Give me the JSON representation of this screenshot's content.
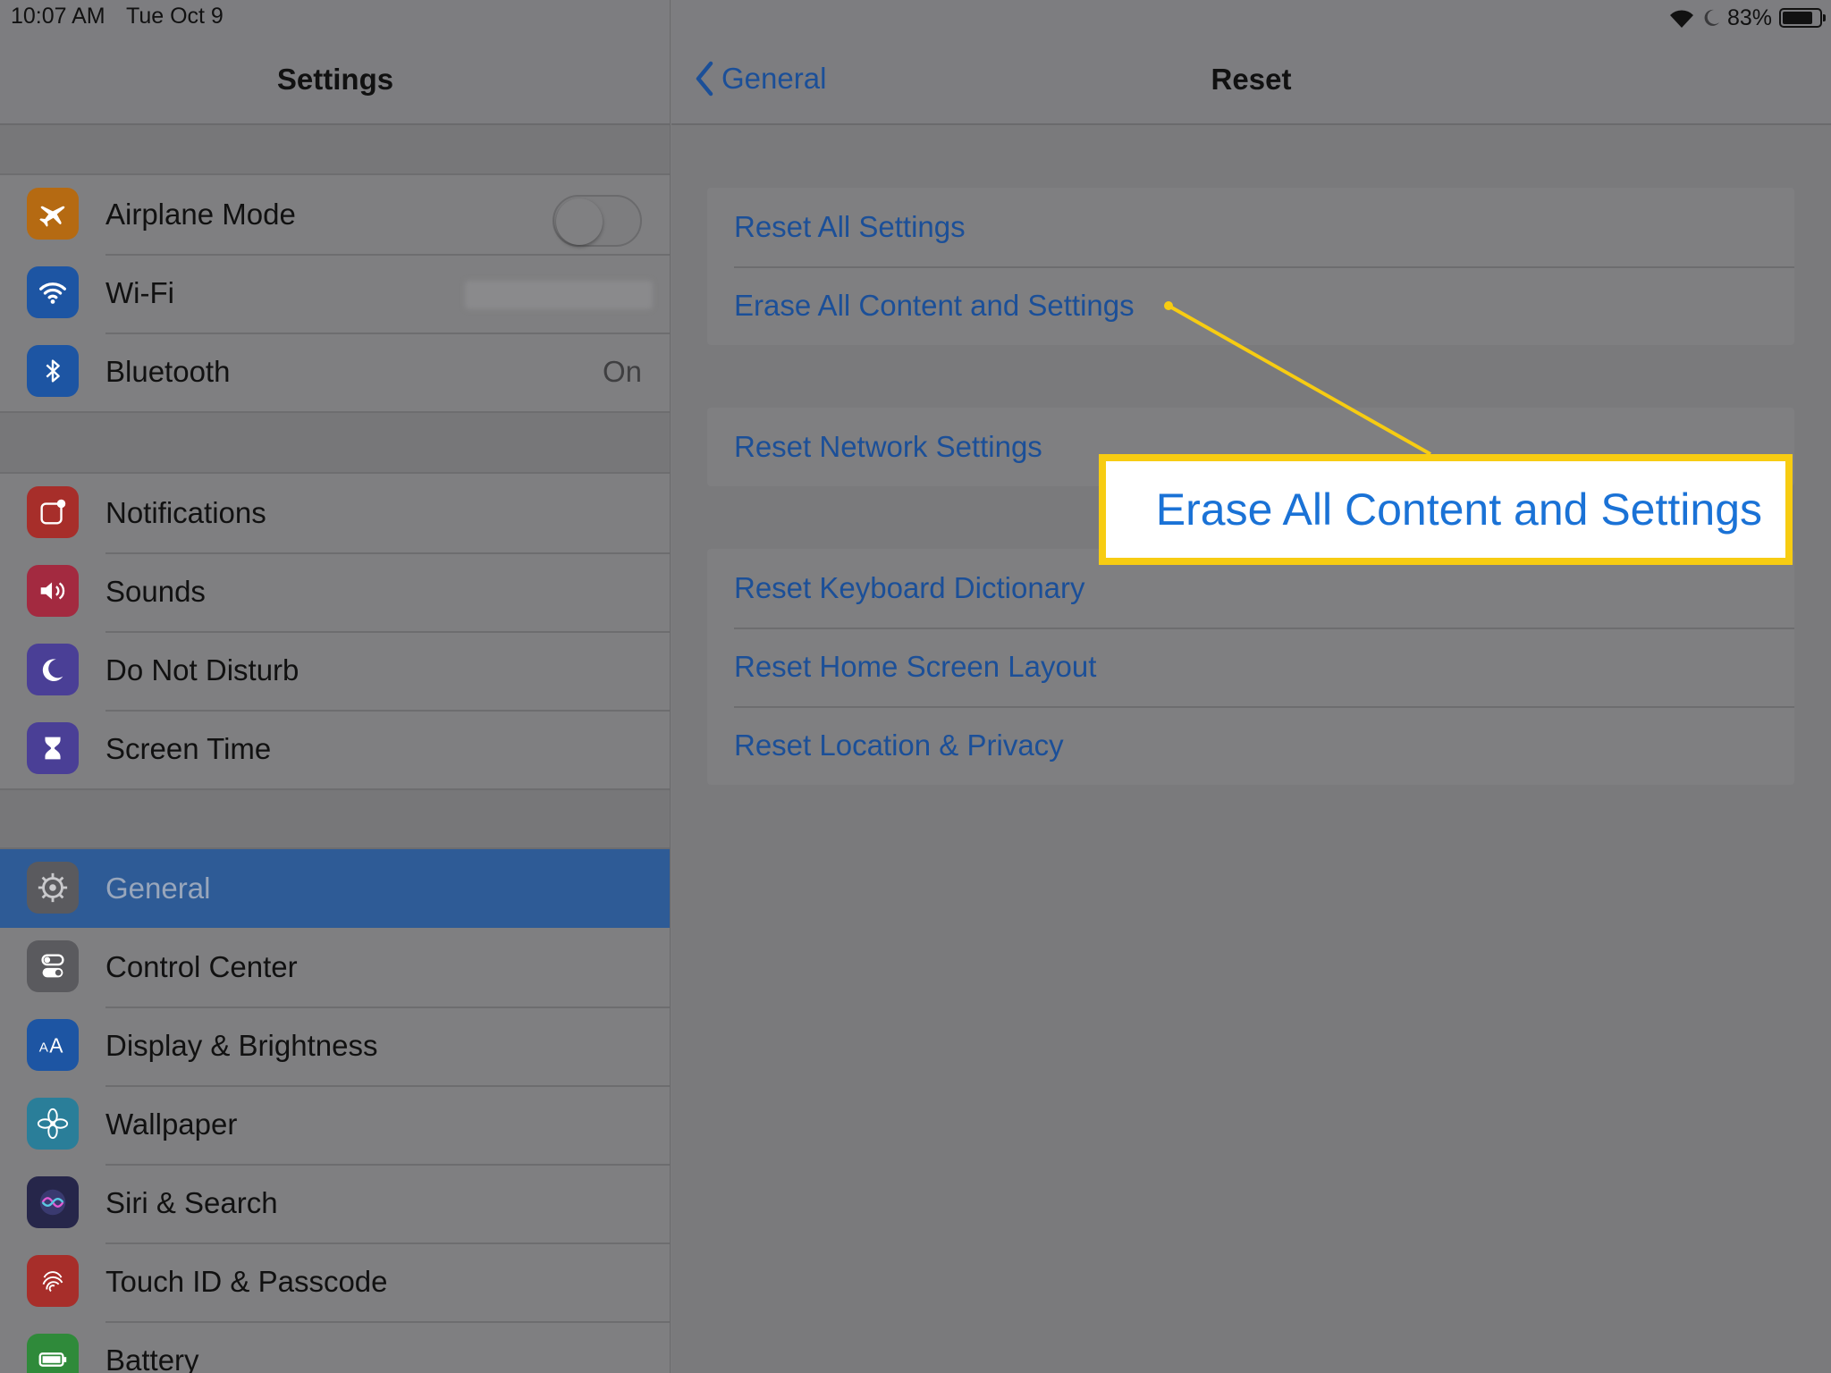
{
  "status": {
    "time": "10:07 AM",
    "date": "Tue Oct 9",
    "battery_percent": "83%",
    "battery_level": 0.83,
    "icons": [
      "wifi-icon",
      "moon-icon",
      "battery-icon"
    ]
  },
  "sidebar": {
    "title": "Settings",
    "groups": [
      {
        "items": [
          {
            "label": "Airplane Mode",
            "icon": "airplane-icon",
            "color": "#b56a12",
            "control": "toggle",
            "toggle_on": false
          },
          {
            "label": "Wi-Fi",
            "icon": "wifi-icon",
            "color": "#1d55a3",
            "value_hidden": true
          },
          {
            "label": "Bluetooth",
            "icon": "bluetooth-icon",
            "color": "#1d55a3",
            "value": "On"
          }
        ]
      },
      {
        "items": [
          {
            "label": "Notifications",
            "icon": "notifications-icon",
            "color": "#a72e2a"
          },
          {
            "label": "Sounds",
            "icon": "speaker-icon",
            "color": "#a32a40"
          },
          {
            "label": "Do Not Disturb",
            "icon": "moon-icon",
            "color": "#4a3f96"
          },
          {
            "label": "Screen Time",
            "icon": "hourglass-icon",
            "color": "#4a3f96"
          }
        ]
      },
      {
        "items": [
          {
            "label": "General",
            "icon": "gear-icon",
            "color": "#5a5a5e",
            "selected": true
          },
          {
            "label": "Control Center",
            "icon": "switches-icon",
            "color": "#5a5a5e"
          },
          {
            "label": "Display & Brightness",
            "icon": "text-size-icon",
            "color": "#1d55a3"
          },
          {
            "label": "Wallpaper",
            "icon": "flower-icon",
            "color": "#2a7e99"
          },
          {
            "label": "Siri & Search",
            "icon": "siri-icon",
            "color": "#26264a"
          },
          {
            "label": "Touch ID & Passcode",
            "icon": "fingerprint-icon",
            "color": "#a72e2a"
          },
          {
            "label": "Battery",
            "icon": "battery-icon",
            "color": "#2f8a3a"
          }
        ]
      }
    ]
  },
  "detail": {
    "back_label": "General",
    "title": "Reset",
    "sections": [
      [
        "Reset All Settings",
        "Erase All Content and Settings"
      ],
      [
        "Reset Network Settings"
      ],
      [
        "Reset Keyboard Dictionary",
        "Reset Home Screen Layout",
        "Reset Location & Privacy"
      ]
    ]
  },
  "callout": {
    "text": "Erase All Content and Settings",
    "border_color": "#f7cc12",
    "text_color": "#1a72d6"
  },
  "colors": {
    "link_blue": "#1b4f98",
    "selected_row": "#2e5b96"
  }
}
